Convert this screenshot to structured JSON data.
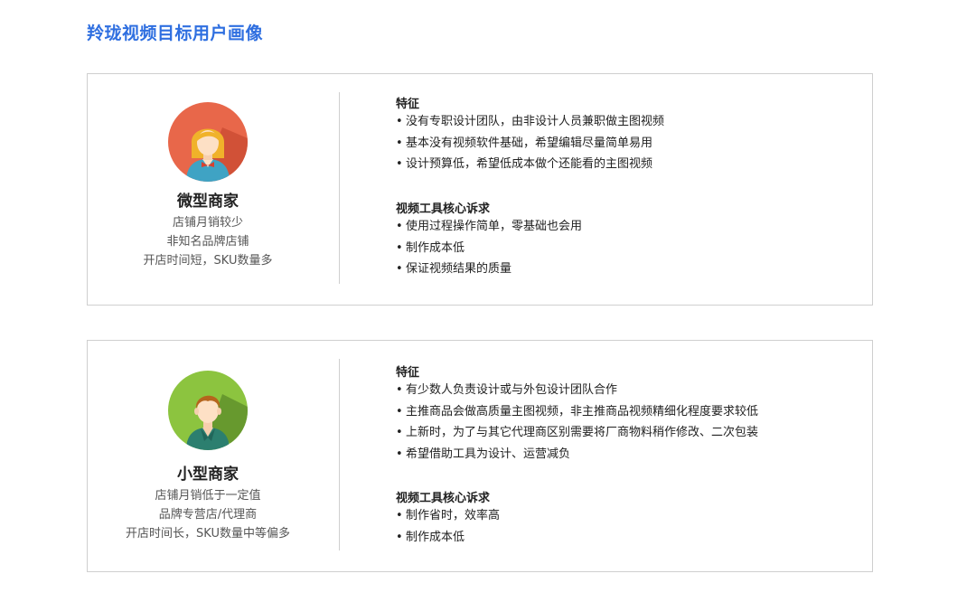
{
  "page": {
    "title": "羚珑视频目标用户画像"
  },
  "personas": [
    {
      "name": "微型商家",
      "avatar_icon": "female-avatar-icon",
      "avatar_color": "#e8674a",
      "desc": [
        "店铺月销较少",
        "非知名品牌店铺",
        "开店时间短，SKU数量多"
      ],
      "features_title": "特征",
      "features": [
        "没有专职设计团队，由非设计人员兼职做主图视频",
        "基本没有视频软件基础，希望编辑尽量简单易用",
        "设计预算低，希望低成本做个还能看的主图视频"
      ],
      "needs_title": "视频工具核心诉求",
      "needs": [
        "使用过程操作简单，零基础也会用",
        "制作成本低",
        "保证视频结果的质量"
      ]
    },
    {
      "name": "小型商家",
      "avatar_icon": "male-avatar-icon",
      "avatar_color": "#8cc43f",
      "desc": [
        "店铺月销低于一定值",
        "品牌专营店/代理商",
        "开店时间长，SKU数量中等偏多"
      ],
      "features_title": "特征",
      "features": [
        "有少数人负责设计或与外包设计团队合作",
        "主推商品会做高质量主图视频，非主推商品视频精细化程度要求较低",
        "上新时，为了与其它代理商区别需要将厂商物料稍作修改、二次包装",
        "希望借助工具为设计、运营减负"
      ],
      "needs_title": "视频工具核心诉求",
      "needs": [
        "制作省时，效率高",
        "制作成本低"
      ]
    }
  ]
}
